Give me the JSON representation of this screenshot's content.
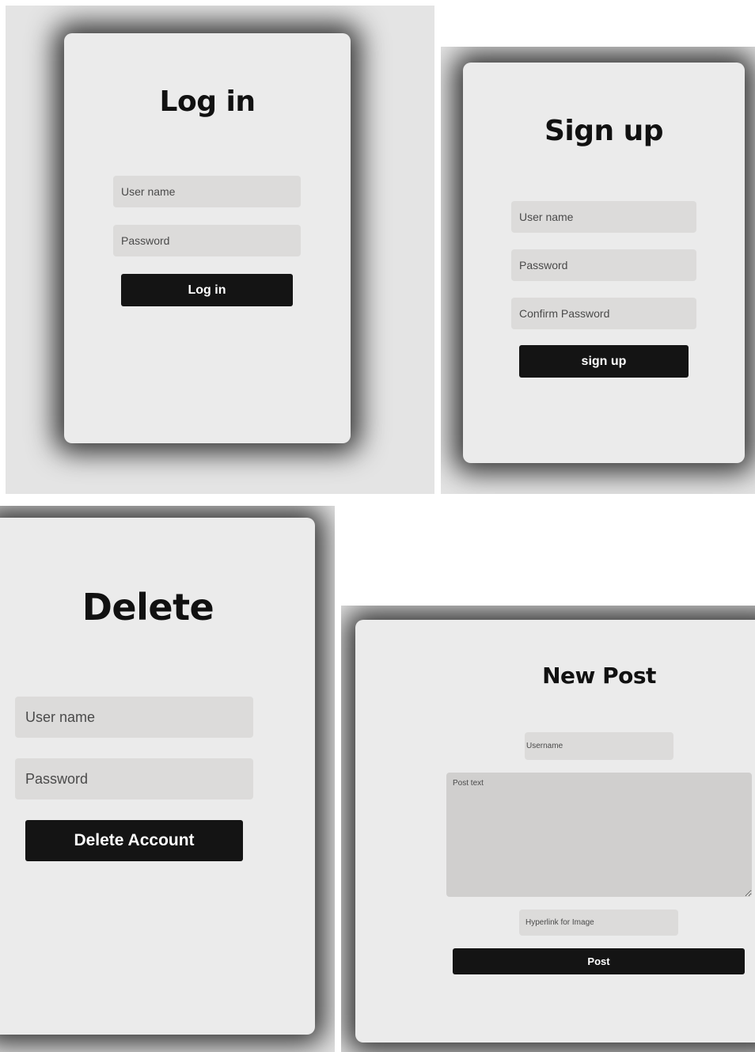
{
  "login": {
    "title": "Log in",
    "username_placeholder": "User name",
    "password_placeholder": "Password",
    "button_label": "Log in"
  },
  "signup": {
    "title": "Sign up",
    "username_placeholder": "User name",
    "password_placeholder": "Password",
    "confirm_placeholder": "Confirm Password",
    "button_label": "sign up"
  },
  "delete": {
    "title": "Delete",
    "username_placeholder": "User name",
    "password_placeholder": "Password",
    "button_label": "Delete Account"
  },
  "new_post": {
    "title": "New Post",
    "username_placeholder": "Username",
    "post_text_placeholder": "Post text",
    "image_link_placeholder": "Hyperlink for Image",
    "button_label": "Post"
  },
  "colors": {
    "card_background": "#ebebeb",
    "field_background": "#dcdbda",
    "button_background": "#141414",
    "button_text": "#ffffff"
  }
}
